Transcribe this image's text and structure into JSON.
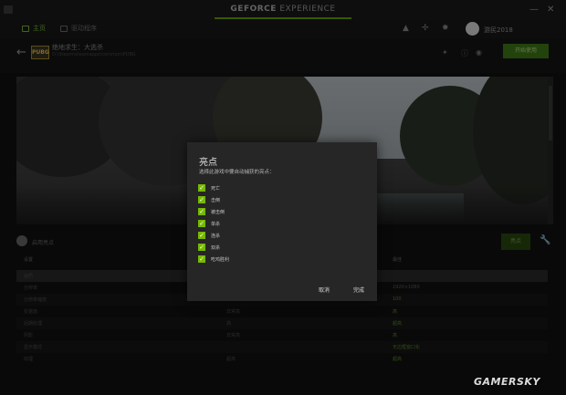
{
  "titlebar": {
    "brand_main": "GEFORCE",
    "brand_sub": " EXPERIENCE",
    "minimize": "—",
    "close": "✕"
  },
  "nav": {
    "home": "主页",
    "drivers": "驱动程序",
    "username": "游民2018"
  },
  "game": {
    "icon_label": "PUBG",
    "title": "绝地求生：大逃杀",
    "path": "D:\\Steam\\steamapps\\common\\PUBG",
    "install_button": "开始使用"
  },
  "highlights_panel": {
    "toggle_label": "启用亮点",
    "button": "亮点"
  },
  "table": {
    "columns": [
      "设置",
      "",
      "",
      "最佳"
    ],
    "rows": [
      [
        "画质",
        "",
        "",
        ""
      ],
      [
        "分辨率",
        "",
        "",
        "1920×1080"
      ],
      [
        "分辨率缩放",
        "",
        "",
        "100"
      ],
      [
        "抗锯齿",
        "",
        "非常高",
        "高"
      ],
      [
        "后期处理",
        "",
        "高",
        "超高"
      ],
      [
        "阴影",
        "",
        "非常高",
        "高"
      ],
      [
        "显示模式",
        "",
        "",
        "无边框窗口化"
      ],
      [
        "纹理",
        "",
        "超高",
        "超高"
      ]
    ]
  },
  "dialog": {
    "title": "亮点",
    "subtitle": "选择此游戏中要自动捕获的亮点：",
    "options": [
      {
        "label": "死亡",
        "checked": true
      },
      {
        "label": "击倒",
        "checked": true
      },
      {
        "label": "被击倒",
        "checked": true
      },
      {
        "label": "单杀",
        "checked": true
      },
      {
        "label": "连杀",
        "checked": true
      },
      {
        "label": "双杀",
        "checked": true
      },
      {
        "label": "吃鸡胜利",
        "checked": true
      }
    ],
    "cancel": "取消",
    "done": "完成"
  },
  "watermark": "GAMERSKY",
  "colors": {
    "accent": "#76b900",
    "dialog_bg": "#262626"
  }
}
